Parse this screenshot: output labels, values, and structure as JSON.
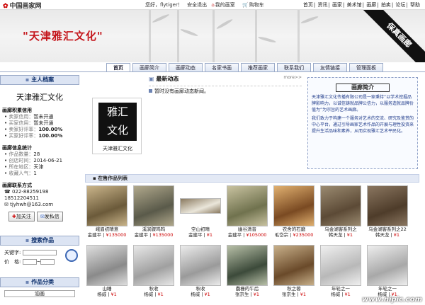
{
  "header": {
    "logo": "中国画家网",
    "greeting": "您好，flytiger！",
    "logout": "安全退出",
    "my_gallery": "我的画室",
    "cart": "购物车",
    "nav": [
      "首页",
      "资讯",
      "画家",
      "美术馆",
      "画廊",
      "拍卖",
      "论坛",
      "帮助"
    ]
  },
  "banner": {
    "title": "\"天津雅汇文化\"",
    "ribbon": "保真画廊"
  },
  "tabs": [
    "首页",
    "画廊简介",
    "画廊动态",
    "名家书画",
    "推荐画家",
    "联系我们",
    "友情链接",
    "管理面板"
  ],
  "sidebar": {
    "profile_head": "主人档案",
    "name": "天津雅汇文化",
    "credit_head": "画廊积累信用",
    "credit": [
      {
        "k": "卖家信用：",
        "v": "暂未开通"
      },
      {
        "k": "买家信用：",
        "v": "暂未开通"
      },
      {
        "k": "卖家好评率：",
        "v": "100.00%"
      },
      {
        "k": "买家好评率：",
        "v": "100.00%"
      }
    ],
    "info_head": "画廊信息统计",
    "info": [
      {
        "k": "作品数量：",
        "v": "28"
      },
      {
        "k": "创店时间：",
        "v": "2014-06-21"
      },
      {
        "k": "所在地区：",
        "v": "天津"
      },
      {
        "k": "收藏人气：",
        "v": "1"
      }
    ],
    "contact_head": "画廊联系方式",
    "phone": "022-88259198 18512204511",
    "email": "tjyhwh@163.com",
    "btn_friend": "加关注",
    "btn_msg": "发私信",
    "search_head": "搜索作品",
    "keyword_label": "关键字:",
    "price_label": "价　格:",
    "price_sep": "~",
    "category_head": "作品分类",
    "category_item": "油画"
  },
  "avatar": {
    "seal": "雅汇文化",
    "name": "天津雅汇文化"
  },
  "news": {
    "title": "最新动态",
    "more": "more>>",
    "line": "暂时没有画廊动态新闻。"
  },
  "intro": {
    "title": "画廊简介",
    "p1": "天津雅汇文化传播有限公司是一家秉持“以学术挖掘品牌影响力，以诚信铸就品牌公信力，以服务造就品牌价值为”为宗旨的艺术画廊。",
    "p2": "我们致力于构建一个serving对艺术的交流、研究及鉴赏的中心平台，通过引导画家艺术作品的开展与理性投资来提升生活品味和素养，从而实现雅汇艺术平民化。"
  },
  "works": {
    "head": "在售作品列表",
    "items": [
      {
        "title": "峨眉初晴意",
        "artist": "金建平",
        "price": "¥135000"
      },
      {
        "title": "溪涧骤鸣鸣",
        "artist": "金建平",
        "price": "¥135000"
      },
      {
        "title": "空山初晴",
        "artist": "金建平",
        "price": "¥1"
      },
      {
        "title": "幽谷清音",
        "artist": "金建平",
        "price": "¥105000"
      },
      {
        "title": "农舍的石磨",
        "artist": "毛岱宗",
        "price": "¥235000"
      },
      {
        "title": "乌金湖客系列之",
        "artist": "韩天龙",
        "price": "¥1"
      },
      {
        "title": "乌金湖客系列之22",
        "artist": "韩天龙",
        "price": "¥1"
      },
      {
        "title": "山睡",
        "artist": "杨威",
        "price": "¥1"
      },
      {
        "title": "秋收",
        "artist": "杨威",
        "price": "¥1"
      },
      {
        "title": "秋收",
        "artist": "杨威",
        "price": "¥1"
      },
      {
        "title": "蠢栅的午后",
        "artist": "张京生",
        "price": "¥1"
      },
      {
        "title": "秋之蓉",
        "artist": "张京生",
        "price": "¥1"
      },
      {
        "title": "年轮之一",
        "artist": "杨威",
        "price": "¥1"
      },
      {
        "title": "年轮之一",
        "artist": "杨威",
        "price": "¥1"
      }
    ]
  },
  "watermark": "www.nipic.com"
}
